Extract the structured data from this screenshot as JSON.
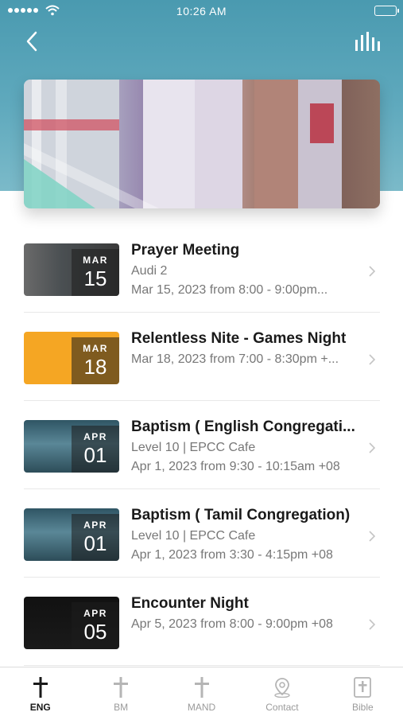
{
  "status": {
    "time": "10:26 AM"
  },
  "events": [
    {
      "title": "Prayer Meeting",
      "lines": [
        "Audi 2",
        "Mar 15, 2023 from 8:00 - 9:00pm..."
      ],
      "month": "MAR",
      "day": "15",
      "thumb_bg": "linear-gradient(90deg,#6a6a6a,#4a4f52 40%,#3a3a3a)"
    },
    {
      "title": "Relentless Nite - Games Night",
      "lines": [
        "Mar 18, 2023 from 7:00 - 8:30pm +..."
      ],
      "month": "MAR",
      "day": "18",
      "thumb_bg": "linear-gradient(90deg,#f5a623,#f5a623)"
    },
    {
      "title": "Baptism ( English Congregati...",
      "lines": [
        "Level 10 | EPCC Cafe",
        "Apr 1, 2023 from 9:30 - 10:15am +08"
      ],
      "month": "APR",
      "day": "01",
      "thumb_bg": "linear-gradient(180deg,#2f5564,#5a8797 45%,#2d4d59)"
    },
    {
      "title": "Baptism ( Tamil Congregation)",
      "lines": [
        "Level 10 | EPCC Cafe",
        "Apr 1, 2023 from 3:30 - 4:15pm +08"
      ],
      "month": "APR",
      "day": "01",
      "thumb_bg": "linear-gradient(180deg,#2f5564,#5a8797 45%,#2d4d59)"
    },
    {
      "title": "Encounter Night",
      "lines": [
        "Apr 5, 2023 from 8:00 - 9:00pm +08"
      ],
      "month": "APR",
      "day": "05",
      "thumb_bg": "linear-gradient(180deg,#111,#1a1a1a)"
    }
  ],
  "tabs": [
    {
      "label": "ENG",
      "icon": "cross-icon",
      "active": true
    },
    {
      "label": "BM",
      "icon": "cross-icon",
      "active": false
    },
    {
      "label": "MAND",
      "icon": "cross-icon",
      "active": false
    },
    {
      "label": "Contact",
      "icon": "location-pin-icon",
      "active": false
    },
    {
      "label": "Bible",
      "icon": "bible-icon",
      "active": false
    }
  ]
}
